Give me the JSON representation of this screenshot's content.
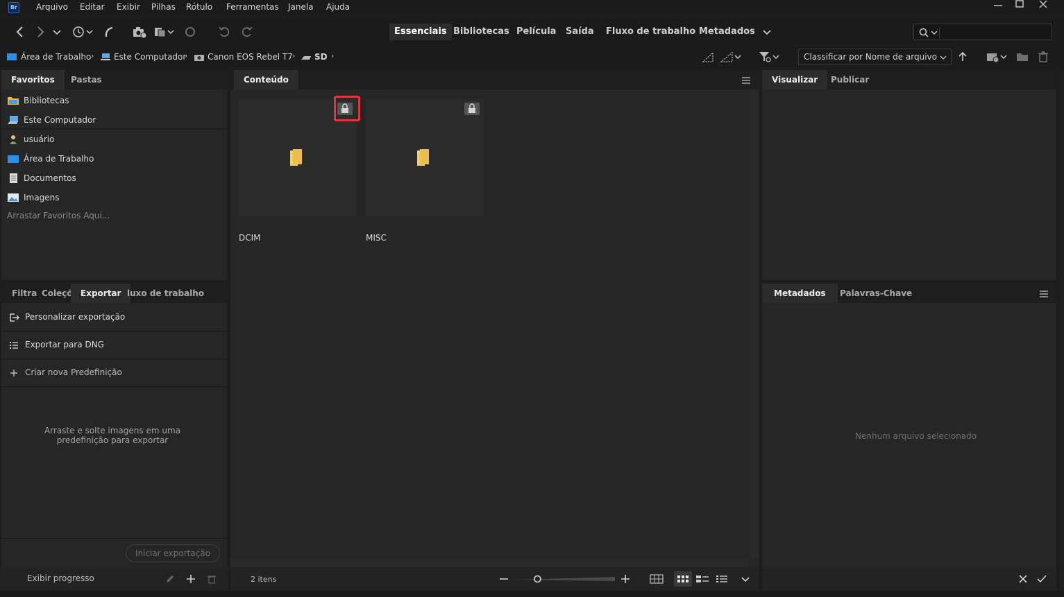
{
  "app": {
    "logo_text": "Br"
  },
  "menu": [
    "Arquivo",
    "Editar",
    "Exibir",
    "Pilhas",
    "Rótulo",
    "Ferramentas",
    "Janela",
    "Ajuda"
  ],
  "workspaces": [
    "Essenciais",
    "Bibliotecas",
    "Película",
    "Saída",
    "Fluxo de trabalho",
    "Metadados"
  ],
  "active_workspace": "Essenciais",
  "search": {
    "value": "",
    "placeholder": ""
  },
  "breadcrumb": [
    "Área de Trabalho",
    "Este Computador",
    "Canon EOS Rebel T7",
    "SD"
  ],
  "sort": {
    "label": "Classificar por Nome de arquivo"
  },
  "left_top": {
    "tabs": [
      "Favoritos",
      "Pastas"
    ],
    "favorites": [
      "Bibliotecas",
      "Este Computador",
      "usuário",
      "Área de Trabalho",
      "Documentos",
      "Imagens"
    ],
    "drop_hint": "Arrastar Favoritos Aqui..."
  },
  "left_bottom": {
    "tabs": [
      "Filtra",
      "Coleçõ",
      "Exportar",
      "luxo de trabalho"
    ],
    "active_tab": "Exportar",
    "items": [
      "Personalizar exportação",
      "Exportar para DNG",
      "Criar nova Predefinição"
    ],
    "hint": "Arraste e solte imagens em uma predefinição para exportar",
    "start_button": "Iniciar exportação",
    "progress_label": "Exibir progresso"
  },
  "content": {
    "tab": "Conteúdo",
    "items": [
      {
        "name": "DCIM",
        "locked": true,
        "highlighted": true
      },
      {
        "name": "MISC",
        "locked": true,
        "highlighted": false
      }
    ],
    "count_label": "2 itens",
    "thumbnail_size_fraction": 0.2
  },
  "right_top": {
    "tabs": [
      "Visualizar",
      "Publicar"
    ]
  },
  "right_bottom": {
    "tabs": [
      "Metadados",
      "Palavras-Chave"
    ],
    "empty_text": "Nenhum arquivo selecionado"
  },
  "colors": {
    "folder": "#f3cf68",
    "highlight": "#e0353c",
    "accent_logo": "#2e66b3"
  }
}
